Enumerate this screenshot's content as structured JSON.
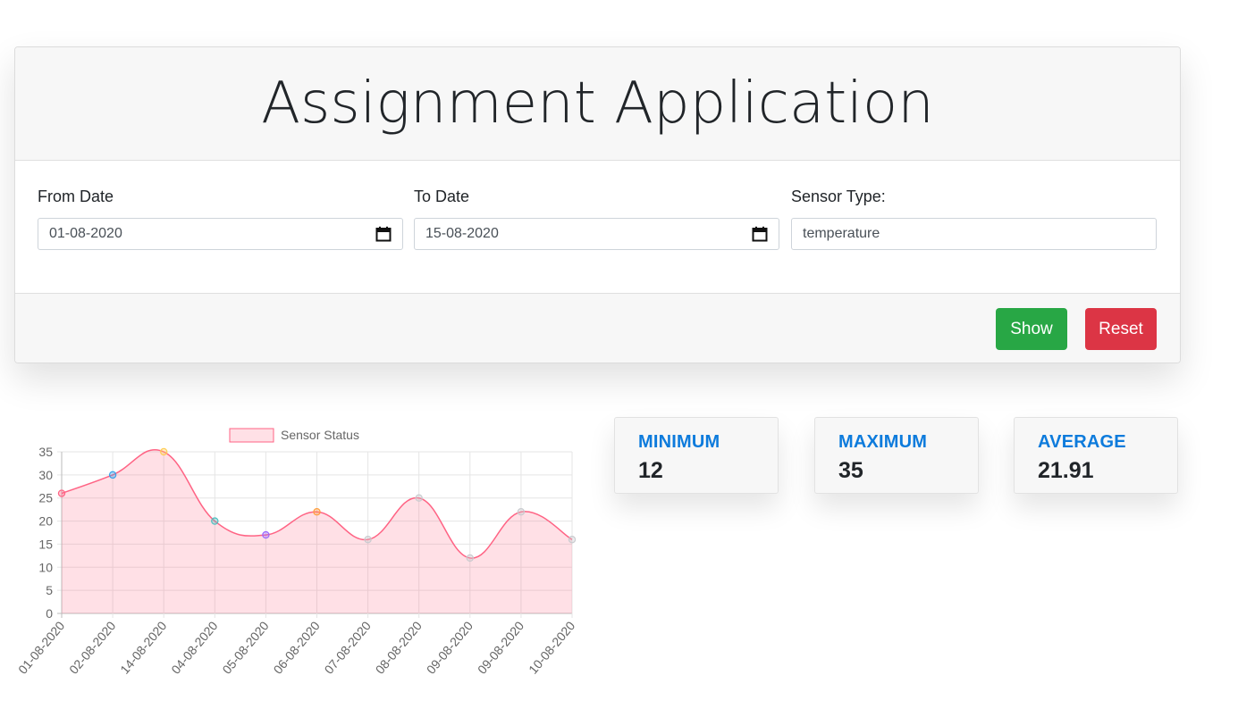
{
  "header": {
    "title": "Assignment Application"
  },
  "form": {
    "from_label": "From Date",
    "from_value": "01-08-2020",
    "to_label": "To Date",
    "to_value": "15-08-2020",
    "sensor_label": "Sensor Type:",
    "sensor_value": "temperature"
  },
  "buttons": {
    "show": "Show",
    "reset": "Reset"
  },
  "stats": [
    {
      "label": "MINIMUM",
      "value": "12"
    },
    {
      "label": "MAXIMUM",
      "value": "35"
    },
    {
      "label": "AVERAGE",
      "value": "21.91"
    }
  ],
  "colors": {
    "show": "#28a745",
    "reset": "#dc3545",
    "stat_label": "#0d7bdc",
    "chart_fill": "rgba(255,99,132,0.2)",
    "chart_line": "#ff6384"
  },
  "chart_data": {
    "type": "area",
    "legend": "Sensor Status",
    "legend_position": "top",
    "grid": true,
    "categories": [
      "01-08-2020",
      "02-08-2020",
      "14-08-2020",
      "04-08-2020",
      "05-08-2020",
      "06-08-2020",
      "07-08-2020",
      "08-08-2020",
      "09-08-2020",
      "09-08-2020",
      "10-08-2020"
    ],
    "series": [
      {
        "name": "Sensor Status",
        "values": [
          26,
          30,
          35,
          20,
          17,
          22,
          16,
          25,
          12,
          22,
          16
        ]
      }
    ],
    "point_colors": [
      "#ff6384",
      "#36a2eb",
      "#ffcd56",
      "#4bc0c0",
      "#9966ff",
      "#ff9f40",
      "#c9cbcf",
      "#c9cbcf",
      "#c9cbcf",
      "#c9cbcf",
      "#c9cbcf"
    ],
    "ylim": [
      0,
      35
    ],
    "yticks": [
      0,
      5,
      10,
      15,
      20,
      25,
      30,
      35
    ]
  }
}
